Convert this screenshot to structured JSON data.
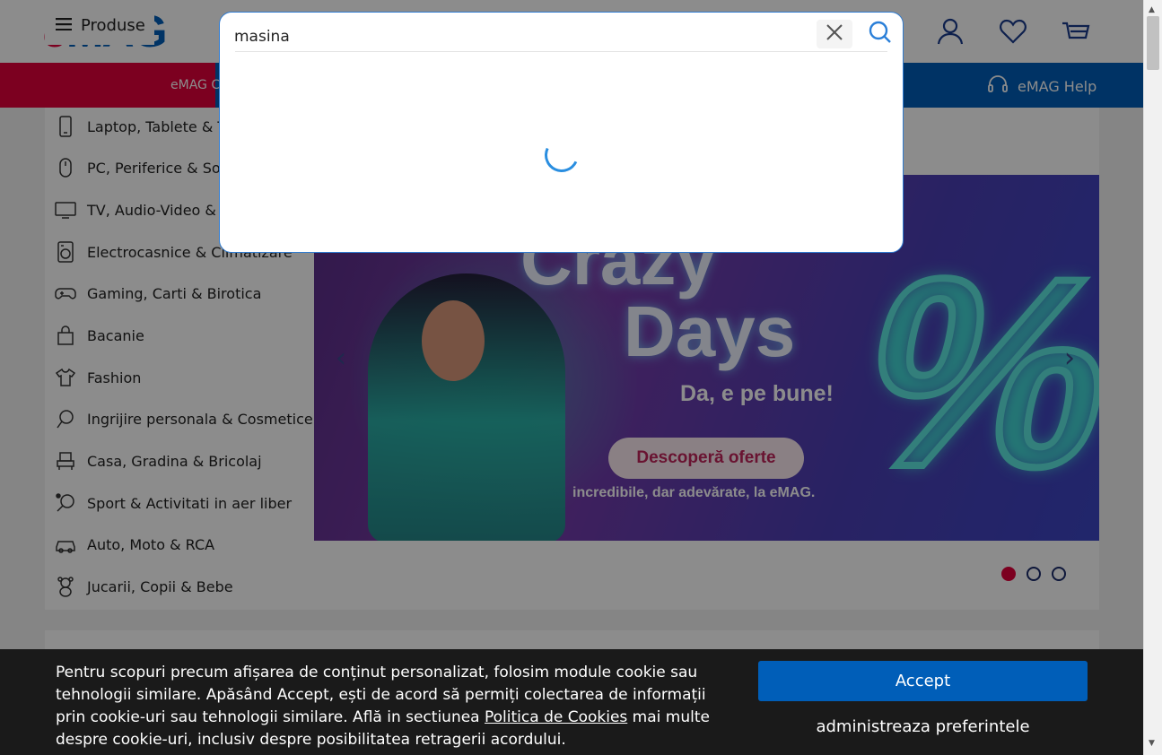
{
  "header": {
    "logo_e": "e",
    "logo_mag": "MAG",
    "produse_label": "Produse",
    "nav_partial": "eMAG C",
    "help_label": "eMAG Help"
  },
  "categories": [
    {
      "label": "Laptop, Tablete & Te",
      "icon": "phone-icon"
    },
    {
      "label": "PC, Periferice & Sof",
      "icon": "mouse-icon"
    },
    {
      "label": "TV, Audio-Video & F",
      "icon": "tv-icon"
    },
    {
      "label": "Electrocasnice & Climatizare",
      "icon": "washing-machine-icon"
    },
    {
      "label": "Gaming, Carti & Birotica",
      "icon": "gamepad-icon"
    },
    {
      "label": "Bacanie",
      "icon": "shopping-bag-icon"
    },
    {
      "label": "Fashion",
      "icon": "tshirt-icon"
    },
    {
      "label": "Ingrijire personala & Cosmetice",
      "icon": "mirror-icon"
    },
    {
      "label": "Casa, Gradina & Bricolaj",
      "icon": "armchair-icon"
    },
    {
      "label": "Sport & Activitati in aer liber",
      "icon": "racket-icon"
    },
    {
      "label": "Auto, Moto & RCA",
      "icon": "car-icon"
    },
    {
      "label": "Jucarii, Copii & Bebe",
      "icon": "teddy-bear-icon"
    }
  ],
  "banner": {
    "title_line1": "Crazy",
    "title_line2": "Days",
    "subtitle": "Da, e pe bune!",
    "cta": "Descoperă oferte",
    "tagline": "incredibile, dar adevărate, la eMAG.",
    "percent": "%",
    "slide_index": 1,
    "slide_count": 3
  },
  "search": {
    "value": "masina",
    "placeholder": ""
  },
  "cookie": {
    "text_before": "Pentru scopuri precum afișarea de conținut personalizat, folosim module cookie sau tehnologii similare. Apăsând Accept, ești de acord să permiți colectarea de informații prin cookie-uri sau tehnologii similare. Află in sectiunea ",
    "link": "Politica de Cookies",
    "text_after": " mai multe despre cookie-uri, inclusiv despre posibilitatea retragerii acordului.",
    "accept_label": "Accept",
    "prefs_label": "administreaza preferintele"
  },
  "colors": {
    "brand_red": "#e2003b",
    "brand_blue": "#005eb8",
    "search_border": "#2f7bd0"
  }
}
